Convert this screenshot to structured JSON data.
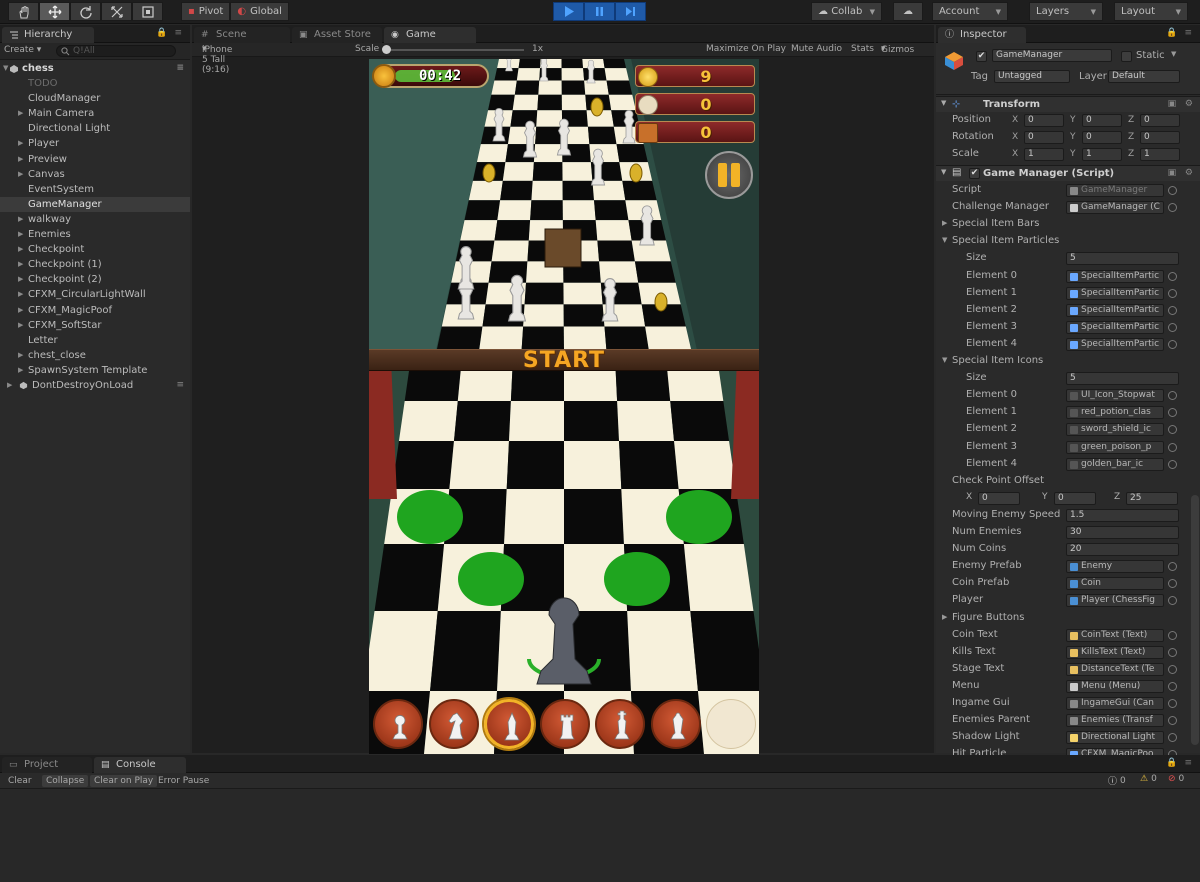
{
  "toolbar": {
    "pivot_label": "Pivot",
    "global_label": "Global",
    "collab_label": "Collab",
    "account_label": "Account",
    "layers_label": "Layers",
    "layout_label": "Layout"
  },
  "hierarchy": {
    "tab_label": "Hierarchy",
    "create_label": "Create",
    "search_placeholder": "Q!All",
    "scene_name": "chess",
    "items": [
      {
        "label": "TODO",
        "expandable": false,
        "dim": true
      },
      {
        "label": "CloudManager",
        "expandable": false
      },
      {
        "label": "Main Camera",
        "expandable": true
      },
      {
        "label": "Directional Light",
        "expandable": false
      },
      {
        "label": "Player",
        "expandable": true
      },
      {
        "label": "Preview",
        "expandable": true
      },
      {
        "label": "Canvas",
        "expandable": true
      },
      {
        "label": "EventSystem",
        "expandable": false
      },
      {
        "label": "GameManager",
        "expandable": false,
        "selected": true
      },
      {
        "label": "walkway",
        "expandable": true
      },
      {
        "label": "Enemies",
        "expandable": true
      },
      {
        "label": "Checkpoint",
        "expandable": true
      },
      {
        "label": "Checkpoint (1)",
        "expandable": true
      },
      {
        "label": "Checkpoint (2)",
        "expandable": true
      },
      {
        "label": "CFXM_CircularLightWall",
        "expandable": true
      },
      {
        "label": "CFXM_MagicPoof",
        "expandable": true
      },
      {
        "label": "CFXM_SoftStar",
        "expandable": true
      },
      {
        "label": "Letter",
        "expandable": false
      },
      {
        "label": "chest_close",
        "expandable": true
      },
      {
        "label": "SpawnSystem Template",
        "expandable": true
      }
    ],
    "dontdestroy_label": "DontDestroyOnLoad"
  },
  "center_tabs": {
    "scene": "Scene",
    "asset_store": "Asset Store",
    "game": "Game"
  },
  "game_options": {
    "resolution": "iPhone 5 Tall (9:16)",
    "scale_label": "Scale",
    "scale_value": "1x",
    "maximize": "Maximize On Play",
    "mute": "Mute Audio",
    "stats": "Stats",
    "gizmos": "Gizmos"
  },
  "game": {
    "timer": "00:42",
    "coins": "9",
    "kills": "0",
    "distance": "0",
    "start_text": "START",
    "piece_buttons": [
      "pawn",
      "knight",
      "bishop",
      "rook",
      "king",
      "queen",
      "empty"
    ],
    "selected_piece": 2,
    "colors": {
      "highlight": "#1fa51f",
      "hud_gold": "#f2b327",
      "board_light": "#f7f1dc",
      "board_dark": "#0a0a0a"
    }
  },
  "inspector": {
    "tab_label": "Inspector",
    "object_name": "GameManager",
    "static_label": "Static",
    "tag_label": "Tag",
    "tag_value": "Untagged",
    "layer_label": "Layer",
    "layer_value": "Default",
    "transform_title": "Transform",
    "position_label": "Position",
    "rotation_label": "Rotation",
    "scale_label": "Scale",
    "position": [
      "0",
      "0",
      "0"
    ],
    "rotation": [
      "0",
      "0",
      "0"
    ],
    "scale": [
      "1",
      "1",
      "1"
    ],
    "script_title": "Game Manager (Script)",
    "script_label": "Script",
    "script_value": "GameManager",
    "challenge_label": "Challenge Manager",
    "challenge_value": "GameManager (C",
    "special_bars_label": "Special Item Bars",
    "special_particles_label": "Special Item Particles",
    "size_label": "Size",
    "particles_size": "5",
    "particles": [
      {
        "label": "Element 0",
        "value": "SpecialItemPartic"
      },
      {
        "label": "Element 1",
        "value": "SpecialItemPartic"
      },
      {
        "label": "Element 2",
        "value": "SpecialItemPartic"
      },
      {
        "label": "Element 3",
        "value": "SpecialItemPartic"
      },
      {
        "label": "Element 4",
        "value": "SpecialItemPartic"
      }
    ],
    "special_icons_label": "Special Item Icons",
    "icons_size": "5",
    "icons": [
      {
        "label": "Element 0",
        "value": "UI_Icon_Stopwat"
      },
      {
        "label": "Element 1",
        "value": "red_potion_clas"
      },
      {
        "label": "Element 2",
        "value": "sword_shield_ic"
      },
      {
        "label": "Element 3",
        "value": "green_poison_p"
      },
      {
        "label": "Element 4",
        "value": "golden_bar_ic"
      }
    ],
    "checkpoint_offset_label": "Check Point Offset",
    "checkpoint_offset": [
      "0",
      "0",
      "25"
    ],
    "moving_speed_label": "Moving Enemy Speed",
    "moving_speed": "1.5",
    "num_enemies_label": "Num Enemies",
    "num_enemies": "30",
    "num_coins_label": "Num Coins",
    "num_coins": "20",
    "enemy_prefab_label": "Enemy Prefab",
    "enemy_prefab": "Enemy",
    "coin_prefab_label": "Coin Prefab",
    "coin_prefab": "Coin",
    "player_label": "Player",
    "player_value": "Player (ChessFig",
    "figure_buttons_label": "Figure Buttons",
    "refs": [
      {
        "label": "Coin Text",
        "value": "CoinText (Text)"
      },
      {
        "label": "Kills Text",
        "value": "KillsText (Text)"
      },
      {
        "label": "Stage Text",
        "value": "DistanceText (Te"
      },
      {
        "label": "Menu",
        "value": "Menu (Menu)"
      },
      {
        "label": "Ingame Gui",
        "value": "IngameGui (Can"
      },
      {
        "label": "Enemies Parent",
        "value": "Enemies (Transf"
      },
      {
        "label": "Shadow Light",
        "value": "Directional Light"
      },
      {
        "label": "Hit Particle",
        "value": "CFXM_MagicPoo"
      }
    ]
  },
  "bottom": {
    "project_tab": "Project",
    "console_tab": "Console",
    "clear": "Clear",
    "collapse": "Collapse",
    "clear_on_play": "Clear on Play",
    "error_pause": "Error Pause",
    "info_count": "0",
    "warn_count": "0",
    "error_count": "0"
  }
}
